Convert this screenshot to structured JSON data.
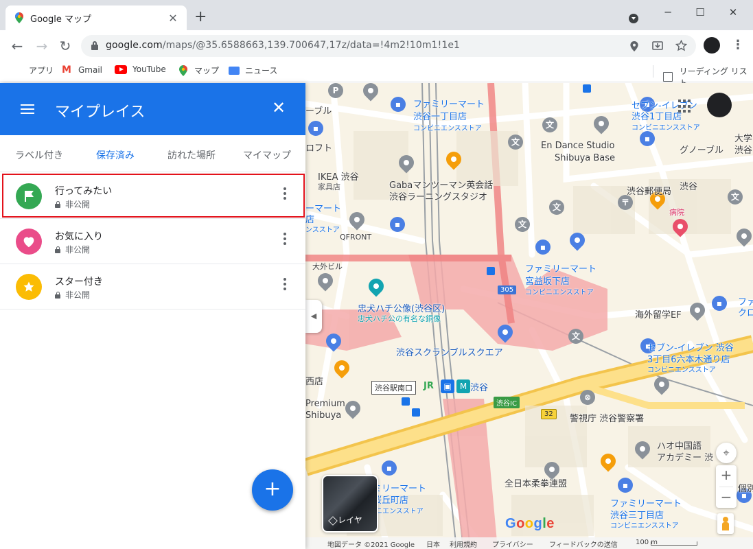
{
  "browser": {
    "tab_title": "Google マップ",
    "tab_close": "✕",
    "new_tab": "+",
    "url_host": "google.com",
    "url_path": "/maps/@35.6588663,139.700647,17z/data=!4m2!10m1!1e1",
    "window_controls": {
      "minimize": "─",
      "maximize": "☐",
      "close": "✕"
    },
    "nav": {
      "back": "←",
      "forward": "→",
      "reload": "↻"
    },
    "bookmarks": [
      {
        "label": "アプリ",
        "icon": "apps-grid-icon"
      },
      {
        "label": "Gmail",
        "icon": "gmail-icon"
      },
      {
        "label": "YouTube",
        "icon": "youtube-icon"
      },
      {
        "label": "マップ",
        "icon": "maps-icon"
      },
      {
        "label": "ニュース",
        "icon": "news-icon"
      }
    ],
    "reading_list": "リーディング リスト"
  },
  "panel": {
    "title": "マイプレイス",
    "close": "✕",
    "tabs": [
      {
        "label": "ラベル付き",
        "active": false
      },
      {
        "label": "保存済み",
        "active": true
      },
      {
        "label": "訪れた場所",
        "active": false
      },
      {
        "label": "マイマップ",
        "active": false
      }
    ],
    "lists": [
      {
        "title": "行ってみたい",
        "privacy": "非公開",
        "color": "#34a853",
        "icon": "flag-icon"
      },
      {
        "title": "お気に入り",
        "privacy": "非公開",
        "color": "#ea4c89",
        "icon": "heart-icon"
      },
      {
        "title": "スター付き",
        "privacy": "非公開",
        "color": "#fbbc04",
        "icon": "star-icon"
      }
    ],
    "fab": "+"
  },
  "map": {
    "labels": [
      "ファミリーマート",
      "渋谷一丁目店",
      "コンビニエンスストア",
      "セブン-イレブン",
      "渋谷1丁目店",
      "コンビニエンスストア",
      "En Dance Studio",
      "Shibuya Base",
      "大学",
      "渋谷",
      "グノーブル",
      "Gabaマンツーマン英会話",
      "渋谷ラーニングスタジオ",
      "渋谷郵便局",
      "渋谷",
      "病院",
      "IKEA 渋谷",
      "家具店",
      "QFRONT",
      "ーマート",
      "店",
      "ンスストア",
      "ファミリーマート",
      "宮益坂下店",
      "コンビニエンスストア",
      "忠犬ハチ公像(渋谷区)",
      "忠犬ハチ公の有名な銅像",
      "海外留学EF",
      "渋谷スクランブルスクエア",
      "セブン-イレブン 渋谷",
      "3丁目6六本木通り店",
      "コンビニエンスストア",
      "渋谷駅南口",
      "渋谷",
      "渋谷IC",
      "警視庁 渋谷警察署",
      "Premium",
      "Shibuya",
      "ハオ中国語",
      "アカデミー 渋",
      "ファミリーマート",
      "渋谷桜丘町店",
      "コンビニエンスストア",
      "全日本柔拳連盟",
      "ファミリーマート",
      "渋谷三丁目店",
      "コンビニエンスストア",
      "ーブル",
      "ロフト",
      "大外ビル",
      "西店",
      "ファ",
      "クロ",
      "個別"
    ],
    "road_badges": [
      "305",
      "32"
    ],
    "layers_label": "レイヤ",
    "google_logo": "Google",
    "attribution": [
      "地図データ ©2021 Google",
      "日本",
      "利用規約",
      "プライバシー",
      "フィードバックの送信",
      "100 m"
    ],
    "zoom_in": "+",
    "zoom_out": "−"
  }
}
